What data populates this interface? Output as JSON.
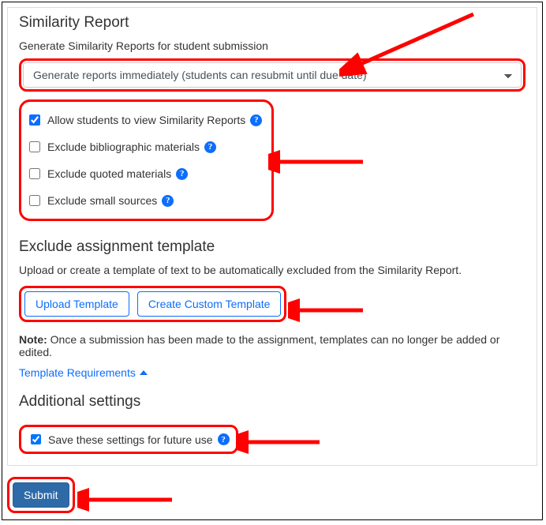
{
  "similarity": {
    "title": "Similarity Report",
    "sublabel": "Generate Similarity Reports for student submission",
    "select_value": "Generate reports immediately (students can resubmit until due date)",
    "options": [
      {
        "label": "Allow students to view Similarity Reports",
        "checked": true
      },
      {
        "label": "Exclude bibliographic materials",
        "checked": false
      },
      {
        "label": "Exclude quoted materials",
        "checked": false
      },
      {
        "label": "Exclude small sources",
        "checked": false
      }
    ]
  },
  "exclude": {
    "title": "Exclude assignment template",
    "desc": "Upload or create a template of text to be automatically excluded from the Similarity Report.",
    "upload_btn": "Upload Template",
    "create_btn": "Create Custom Template",
    "note_label": "Note:",
    "note_text": " Once a submission has been made to the assignment, templates can no longer be added or edited.",
    "requirements_label": "Template Requirements"
  },
  "additional": {
    "title": "Additional settings",
    "save_label": "Save these settings for future use",
    "save_checked": true
  },
  "submit_label": "Submit"
}
